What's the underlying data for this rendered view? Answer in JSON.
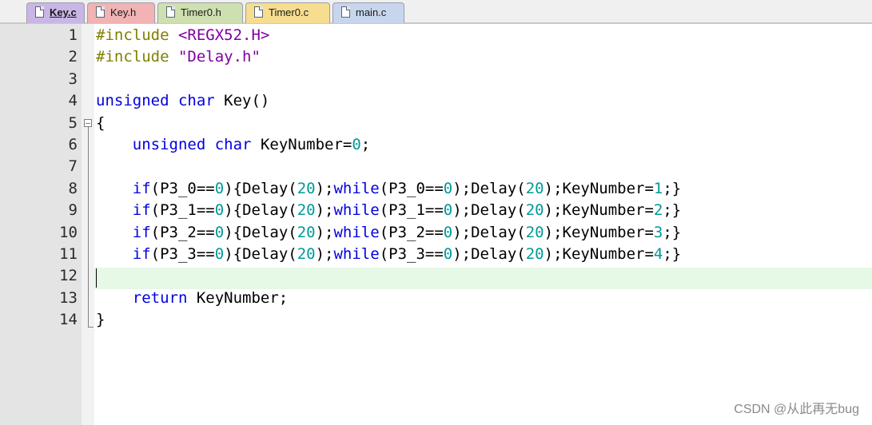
{
  "tabs": [
    {
      "label": "Key.c",
      "color": "#c9b6e6",
      "active": true
    },
    {
      "label": "Key.h",
      "color": "#f1b3b3",
      "active": false
    },
    {
      "label": "Timer0.h",
      "color": "#cfe0b0",
      "active": false
    },
    {
      "label": "Timer0.c",
      "color": "#f7dd8f",
      "active": false
    },
    {
      "label": "main.c",
      "color": "#c7d6ec",
      "active": false
    }
  ],
  "editor": {
    "current_line": 12,
    "lines": [
      {
        "n": "1",
        "tokens": [
          {
            "t": "#include ",
            "c": "pre"
          },
          {
            "t": "<REGX52.H>",
            "c": "str"
          }
        ]
      },
      {
        "n": "2",
        "tokens": [
          {
            "t": "#include ",
            "c": "pre"
          },
          {
            "t": "\"Delay.h\"",
            "c": "str"
          }
        ]
      },
      {
        "n": "3",
        "tokens": []
      },
      {
        "n": "4",
        "tokens": [
          {
            "t": "unsigned",
            "c": "kw"
          },
          {
            "t": " ",
            "c": "id"
          },
          {
            "t": "char",
            "c": "kw"
          },
          {
            "t": " Key()",
            "c": "id"
          }
        ]
      },
      {
        "n": "5",
        "tokens": [
          {
            "t": "{",
            "c": "id"
          }
        ]
      },
      {
        "n": "6",
        "tokens": [
          {
            "t": "    ",
            "c": "id"
          },
          {
            "t": "unsigned",
            "c": "kw"
          },
          {
            "t": " ",
            "c": "id"
          },
          {
            "t": "char",
            "c": "kw"
          },
          {
            "t": " KeyNumber=",
            "c": "id"
          },
          {
            "t": "0",
            "c": "num"
          },
          {
            "t": ";",
            "c": "id"
          }
        ]
      },
      {
        "n": "7",
        "tokens": []
      },
      {
        "n": "8",
        "tokens": [
          {
            "t": "    ",
            "c": "id"
          },
          {
            "t": "if",
            "c": "kw"
          },
          {
            "t": "(P3_0==",
            "c": "id"
          },
          {
            "t": "0",
            "c": "num"
          },
          {
            "t": "){Delay(",
            "c": "id"
          },
          {
            "t": "20",
            "c": "num"
          },
          {
            "t": ");",
            "c": "id"
          },
          {
            "t": "while",
            "c": "kw"
          },
          {
            "t": "(P3_0==",
            "c": "id"
          },
          {
            "t": "0",
            "c": "num"
          },
          {
            "t": ");Delay(",
            "c": "id"
          },
          {
            "t": "20",
            "c": "num"
          },
          {
            "t": ");KeyNumber=",
            "c": "id"
          },
          {
            "t": "1",
            "c": "num"
          },
          {
            "t": ";}",
            "c": "id"
          }
        ]
      },
      {
        "n": "9",
        "tokens": [
          {
            "t": "    ",
            "c": "id"
          },
          {
            "t": "if",
            "c": "kw"
          },
          {
            "t": "(P3_1==",
            "c": "id"
          },
          {
            "t": "0",
            "c": "num"
          },
          {
            "t": "){Delay(",
            "c": "id"
          },
          {
            "t": "20",
            "c": "num"
          },
          {
            "t": ");",
            "c": "id"
          },
          {
            "t": "while",
            "c": "kw"
          },
          {
            "t": "(P3_1==",
            "c": "id"
          },
          {
            "t": "0",
            "c": "num"
          },
          {
            "t": ");Delay(",
            "c": "id"
          },
          {
            "t": "20",
            "c": "num"
          },
          {
            "t": ");KeyNumber=",
            "c": "id"
          },
          {
            "t": "2",
            "c": "num"
          },
          {
            "t": ";}",
            "c": "id"
          }
        ]
      },
      {
        "n": "10",
        "tokens": [
          {
            "t": "    ",
            "c": "id"
          },
          {
            "t": "if",
            "c": "kw"
          },
          {
            "t": "(P3_2==",
            "c": "id"
          },
          {
            "t": "0",
            "c": "num"
          },
          {
            "t": "){Delay(",
            "c": "id"
          },
          {
            "t": "20",
            "c": "num"
          },
          {
            "t": ");",
            "c": "id"
          },
          {
            "t": "while",
            "c": "kw"
          },
          {
            "t": "(P3_2==",
            "c": "id"
          },
          {
            "t": "0",
            "c": "num"
          },
          {
            "t": ");Delay(",
            "c": "id"
          },
          {
            "t": "20",
            "c": "num"
          },
          {
            "t": ");KeyNumber=",
            "c": "id"
          },
          {
            "t": "3",
            "c": "num"
          },
          {
            "t": ";}",
            "c": "id"
          }
        ]
      },
      {
        "n": "11",
        "tokens": [
          {
            "t": "    ",
            "c": "id"
          },
          {
            "t": "if",
            "c": "kw"
          },
          {
            "t": "(P3_3==",
            "c": "id"
          },
          {
            "t": "0",
            "c": "num"
          },
          {
            "t": "){Delay(",
            "c": "id"
          },
          {
            "t": "20",
            "c": "num"
          },
          {
            "t": ");",
            "c": "id"
          },
          {
            "t": "while",
            "c": "kw"
          },
          {
            "t": "(P3_3==",
            "c": "id"
          },
          {
            "t": "0",
            "c": "num"
          },
          {
            "t": ");Delay(",
            "c": "id"
          },
          {
            "t": "20",
            "c": "num"
          },
          {
            "t": ");KeyNumber=",
            "c": "id"
          },
          {
            "t": "4",
            "c": "num"
          },
          {
            "t": ";}",
            "c": "id"
          }
        ]
      },
      {
        "n": "12",
        "tokens": []
      },
      {
        "n": "13",
        "tokens": [
          {
            "t": "    ",
            "c": "id"
          },
          {
            "t": "return",
            "c": "kw"
          },
          {
            "t": " KeyNumber;",
            "c": "id"
          }
        ]
      },
      {
        "n": "14",
        "tokens": [
          {
            "t": "}",
            "c": "id"
          }
        ]
      }
    ]
  },
  "watermark": "CSDN @从此再无bug"
}
